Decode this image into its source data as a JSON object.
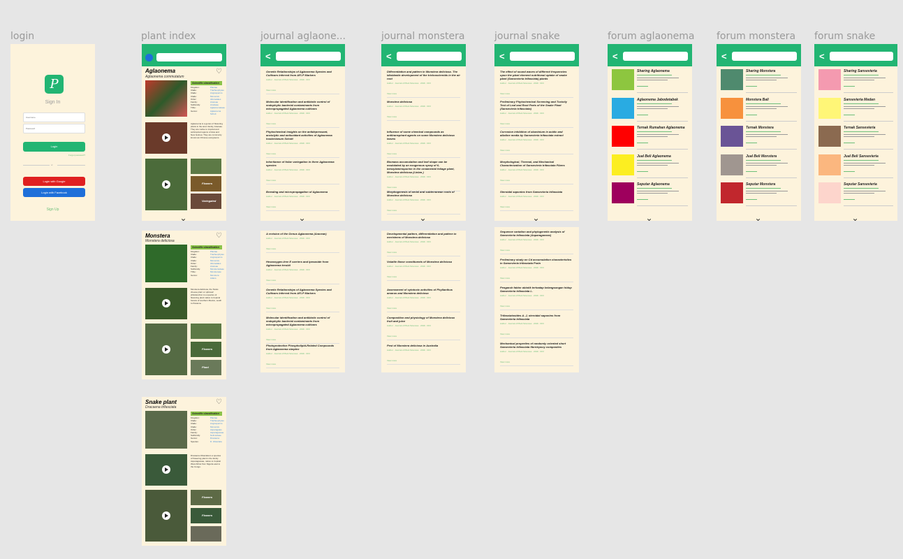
{
  "frames": {
    "login": "login",
    "plant_index": "plant index",
    "journal_aglaonema": "journal aglaone...",
    "journal_monstera": "journal monstera",
    "journal_snake": "journal snake",
    "forum_aglaonema": "forum aglaonema",
    "forum_monstera": "forum monstera",
    "forum_snake": "forum snake"
  },
  "login": {
    "title": "Sign In",
    "username_placeholder": "Username",
    "password_placeholder": "Password",
    "login_button": "Login",
    "forgot": "Forgot password?",
    "divider": "or",
    "google_button": "Login with Google",
    "facebook_button": "Login with Facebook",
    "signup": "Sign Up",
    "logo_letter": "P",
    "colors": {
      "green": "#22b573",
      "google": "#e02020",
      "facebook": "#1e6fd9"
    }
  },
  "plants": [
    {
      "name": "Aglaonema",
      "scientific": "Aglaonema commutatum",
      "classification_title": "Scientific classification",
      "classification": [
        [
          "Kingdom:",
          "Plantae"
        ],
        [
          "Clade:",
          "Tracheophytes"
        ],
        [
          "Clade:",
          "Angiosperms"
        ],
        [
          "Clade:",
          "Monocots"
        ],
        [
          "Order:",
          "Alismatales"
        ],
        [
          "Family:",
          "Araceae"
        ],
        [
          "Subfamily:",
          "Aroideae"
        ],
        [
          "Tribe:",
          "Aglaonemateae"
        ],
        [
          "Genus:",
          "Aglaonema"
        ],
        [
          "",
          "Schott"
        ]
      ],
      "tags": [
        "Flowers",
        "Variegated"
      ]
    },
    {
      "name": "Monstera",
      "scientific": "Monstera deliciosa",
      "classification_title": "Scientific classification",
      "classification": [
        [
          "Kingdom:",
          "Plantae"
        ],
        [
          "Clade:",
          "Tracheophytes"
        ],
        [
          "Clade:",
          "Angiosperms"
        ],
        [
          "Clade:",
          "Monocots"
        ],
        [
          "Order:",
          "Alismatales"
        ],
        [
          "Family:",
          "Araceae"
        ],
        [
          "Subfamily:",
          "Monsteroideae"
        ],
        [
          "Tribe:",
          "Monstereae"
        ],
        [
          "Genus:",
          "Monstera"
        ],
        [
          "",
          "Adans."
        ]
      ],
      "tags": [
        "Flowers",
        "Plant"
      ]
    },
    {
      "name": "Snake plant",
      "scientific": "Dracaena trifasciata",
      "classification_title": "Scientific classification",
      "classification": [
        [
          "Kingdom:",
          "Plantae"
        ],
        [
          "Clade:",
          "Tracheophytes"
        ],
        [
          "Clade:",
          "Angiosperms"
        ],
        [
          "Clade:",
          "Monocots"
        ],
        [
          "Order:",
          "Asparagales"
        ],
        [
          "Family:",
          "Asparagaceae"
        ],
        [
          "Subfamily:",
          "Nolinoideae"
        ],
        [
          "Genus:",
          "Dracaena"
        ],
        [
          "Species:",
          "D. trifasciata"
        ]
      ],
      "tags": [
        "Flowers",
        "Flowers"
      ]
    }
  ],
  "journal_aglaonema": [
    "Genetic Relationships of Aglaonema Species and Cultivars Inferred from AFLP Markers",
    "Molecular identification and antibiotic control of endophytic bacterial contaminants from micropropagated Aglaonema cultivars",
    "Phytochemical insights on the antidepressant, anxiolytic and antioxidant activities of Aglaonema hookerianum Schott",
    "Inheritance of foliar variegation in three Aglaonema species",
    "Breeding and micropropagation of Aglaonema",
    "A revision of the Genus Aglaonema (Araceae)",
    "Hexaoxygen-free E carriers and Ipecaside from Aglaonema treubii",
    "Genetic Relationships of Aglaonema Species and Cultivars Inferred from AFLP Markers",
    "Molecular identification and antibiotic control of endophytic bacterial contaminants from micropropagated Aglaonema cultivars",
    "Photoprotective Phospholipid-Related Compounds from Aglaonema simplex"
  ],
  "journal_monstera": [
    "Differentiation and pattern in Monstera deliciosa. The idioblastic development of the trichosclereids in the air root",
    "Monstera deliciosa",
    "Influence of some chemical compounds as antitranspirant agents on some Monstera deliciosa leaves",
    "Biomass accumulation and leaf shape can be modulated by an exogenous spray of 6-benzylaminopurine in the ornamental foliage plant, Monstera deliciosa (Liebm.)",
    "Morphogenesis of aerial and subterranean roots of Monstera deliciosa",
    "Developmental pattern, differentiation and pattern in meristems of Monstera deliciosa",
    "Volatile flavor constituents of Monstera deliciosa",
    "Assessment of cytotoxic activities of Phyllanthus amarus and Monstera deliciosa",
    "Composition and physiology of Monstera deliciosa fruit and juice",
    "Pest of Monstera deliciosa in Australia"
  ],
  "journal_snake": [
    "The effect of sound waves of different frequencies upon the plant element nutritional uptake of snake plant (Sansevieria trifasciata) plants",
    "Preliminary Phytochemical Screening and Toxicity Test of Leaf and Root Parts of the Snake Plant (Sansevieria trifasciata)",
    "Corrosion inhibition of aluminium in acidic and alkaline media by Sansevieria trifasciata extract",
    "Morphological, Thermal, and Mechanical Characterization of Sansevieria trifasciata Fibers",
    "Steroidal saponins from Sansevieria trifasciata",
    "Sequence variation and phylogenetic analysis of Sansevieria trifasciata (Asparagaceae)",
    "Preliminary study on Cd accumulation characteristics in Sansevieria trifasciata Prain",
    "Pengaruh faktor abiotik terhadap kelangsungan hidup Sansevieria trifasciata L.",
    "Trifasciatosides A–J, steroidal saponins from Sansevieria trifasciata",
    "Mechanical properties of randomly oriented short Sansevieria trifasciata fibre/epoxy composites"
  ],
  "journal_meta": "Author · Journal of Plant Sciences · 2019 · DOI",
  "journal_more": "View more",
  "forum_aglaonema": [
    {
      "title": "Sharing Aglaonema",
      "color": "#8dc63f"
    },
    {
      "title": "Aglaonema Jabodetabek",
      "color": "#29abe2"
    },
    {
      "title": "Ternak Rumahan Aglaonema",
      "color": "#ff0000"
    },
    {
      "title": "Jual Beli Aglaonema",
      "color": "#fcee21"
    },
    {
      "title": "Seputar Aglaonema",
      "color": "#9e005d"
    }
  ],
  "forum_monstera": [
    {
      "title": "Sharing Monstera",
      "color": "#4f8a6e"
    },
    {
      "title": "Monstera Bali",
      "color": "#f7913d"
    },
    {
      "title": "Ternak Monstera",
      "color": "#6a5496"
    },
    {
      "title": "Jual Beli Monstera",
      "color": "#a09690"
    },
    {
      "title": "Seputar Monstera",
      "color": "#c1272d"
    }
  ],
  "forum_snake": [
    {
      "title": "Sharing Sansevieria",
      "color": "#f49ab0"
    },
    {
      "title": "Sansevieria Medan",
      "color": "#fff677"
    },
    {
      "title": "Ternak Sansevieria",
      "color": "#8b6a50"
    },
    {
      "title": "Jual Beli Sansevieria",
      "color": "#fbb77f"
    },
    {
      "title": "Seputar Sansevieria",
      "color": "#fdd5cc"
    }
  ],
  "icons": {
    "back": "<",
    "chevron": "⌄",
    "heart": "♡"
  }
}
